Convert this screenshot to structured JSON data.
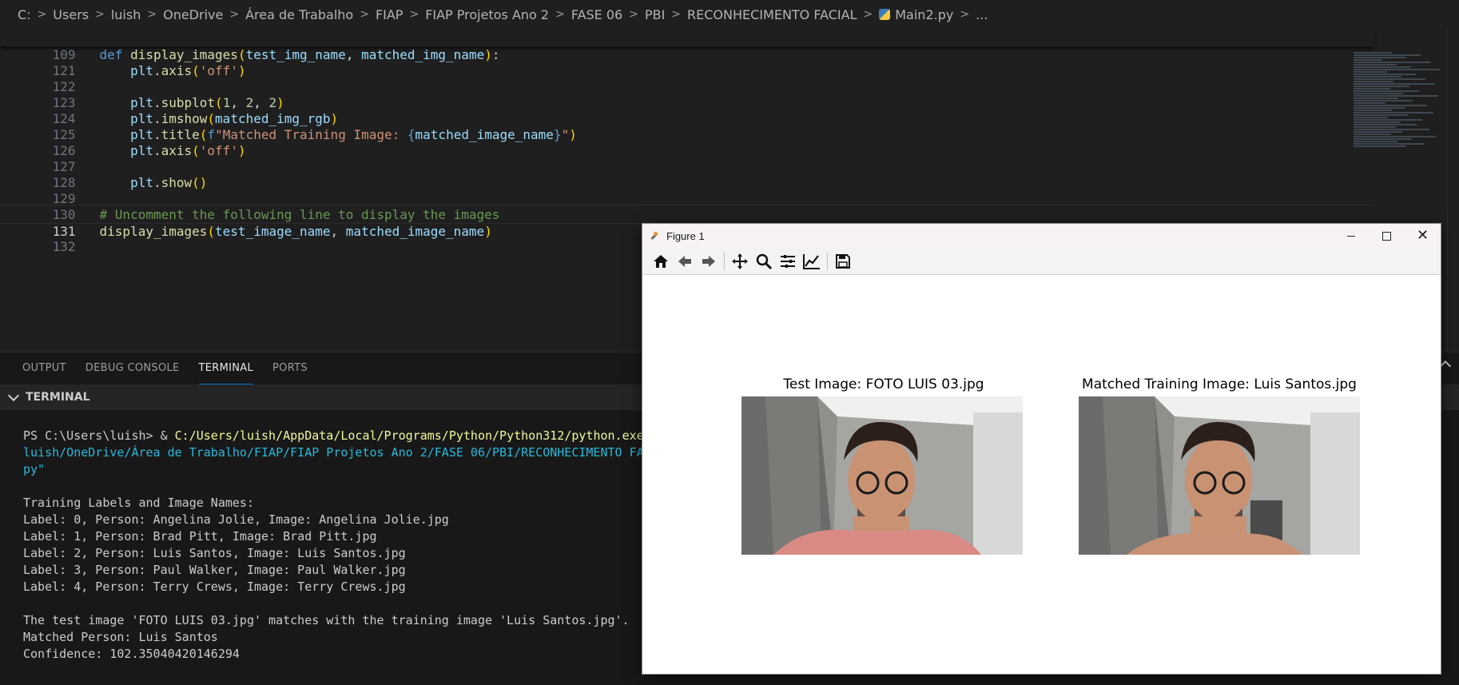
{
  "breadcrumb": [
    "C:",
    "Users",
    "luish",
    "OneDrive",
    "Área de Trabalho",
    "FIAP",
    "FIAP Projetos Ano 2",
    "FASE 06",
    "PBI",
    "RECONHECIMENTO FACIAL",
    "Main2.py",
    "..."
  ],
  "editor": {
    "sticky": {
      "ln": "109",
      "kw": "def",
      "fn": "display_images",
      "p1": "test_img_name",
      "p2": "matched_img_name"
    },
    "lines": {
      "l121": {
        "ln": "121",
        "obj": "plt",
        "call": "axis",
        "arg": "'off'"
      },
      "l122": {
        "ln": "122"
      },
      "l123": {
        "ln": "123",
        "obj": "plt",
        "call": "subplot",
        "a1": "1",
        "a2": "2",
        "a3": "2"
      },
      "l124": {
        "ln": "124",
        "obj": "plt",
        "call": "imshow",
        "arg": "matched_img_rgb"
      },
      "l125": {
        "ln": "125",
        "obj": "plt",
        "call": "title",
        "prefix": "f",
        "str": "\"Matched Training Image: ",
        "var": "matched_image_name",
        "end": "\""
      },
      "l126": {
        "ln": "126",
        "obj": "plt",
        "call": "axis",
        "arg": "'off'"
      },
      "l127": {
        "ln": "127"
      },
      "l128": {
        "ln": "128",
        "obj": "plt",
        "call": "show"
      },
      "l129": {
        "ln": "129"
      },
      "l130": {
        "ln": "130",
        "comment": "# Uncomment the following line to display the images"
      },
      "l131": {
        "ln": "131",
        "fn": "display_images",
        "a1": "test_image_name",
        "a2": "matched_image_name"
      },
      "l132": {
        "ln": "132"
      }
    }
  },
  "panel": {
    "tabs": [
      "OUTPUT",
      "DEBUG CONSOLE",
      "TERMINAL",
      "PORTS"
    ],
    "terminal_header": "TERMINAL",
    "prompt": "PS C:\\Users\\luish> & ",
    "cmd_path": "C:/Users/luish/AppData/Local/Programs/Python/Python312/python.exe",
    "cmd_line2": "luish/OneDrive/Área de Trabalho/FIAP/FIAP Projetos Ano 2/FASE 06/PBI/RECONHECIMENTO FA",
    "cmd_line3": "py\"",
    "output": [
      "Training Labels and Image Names:",
      "Label: 0, Person: Angelina Jolie, Image: Angelina Jolie.jpg",
      "Label: 1, Person: Brad Pitt, Image: Brad Pitt.jpg",
      "Label: 2, Person: Luis Santos, Image: Luis Santos.jpg",
      "Label: 3, Person: Paul Walker, Image: Paul Walker.jpg",
      "Label: 4, Person: Terry Crews, Image: Terry Crews.jpg"
    ],
    "result": [
      "The test image 'FOTO LUIS 03.jpg' matches with the training image 'Luis Santos.jpg'.",
      "Matched Person: Luis Santos",
      "Confidence: 102.35040420146294"
    ]
  },
  "figure": {
    "title": "Figure 1",
    "close_glyph": "✕",
    "toolbar_icons": [
      "home-icon",
      "back-arrow-icon",
      "forward-arrow-icon",
      "pan-icon",
      "zoom-icon",
      "configure-subplots-icon",
      "edit-axis-icon",
      "save-icon"
    ],
    "left_title": "Test Image: FOTO LUIS 03.jpg",
    "right_title": "Matched Training Image: Luis Santos.jpg"
  },
  "colors": {
    "accent": "#0078d4",
    "editor_bg": "#1f1f1f",
    "panel_bg": "#181818"
  }
}
